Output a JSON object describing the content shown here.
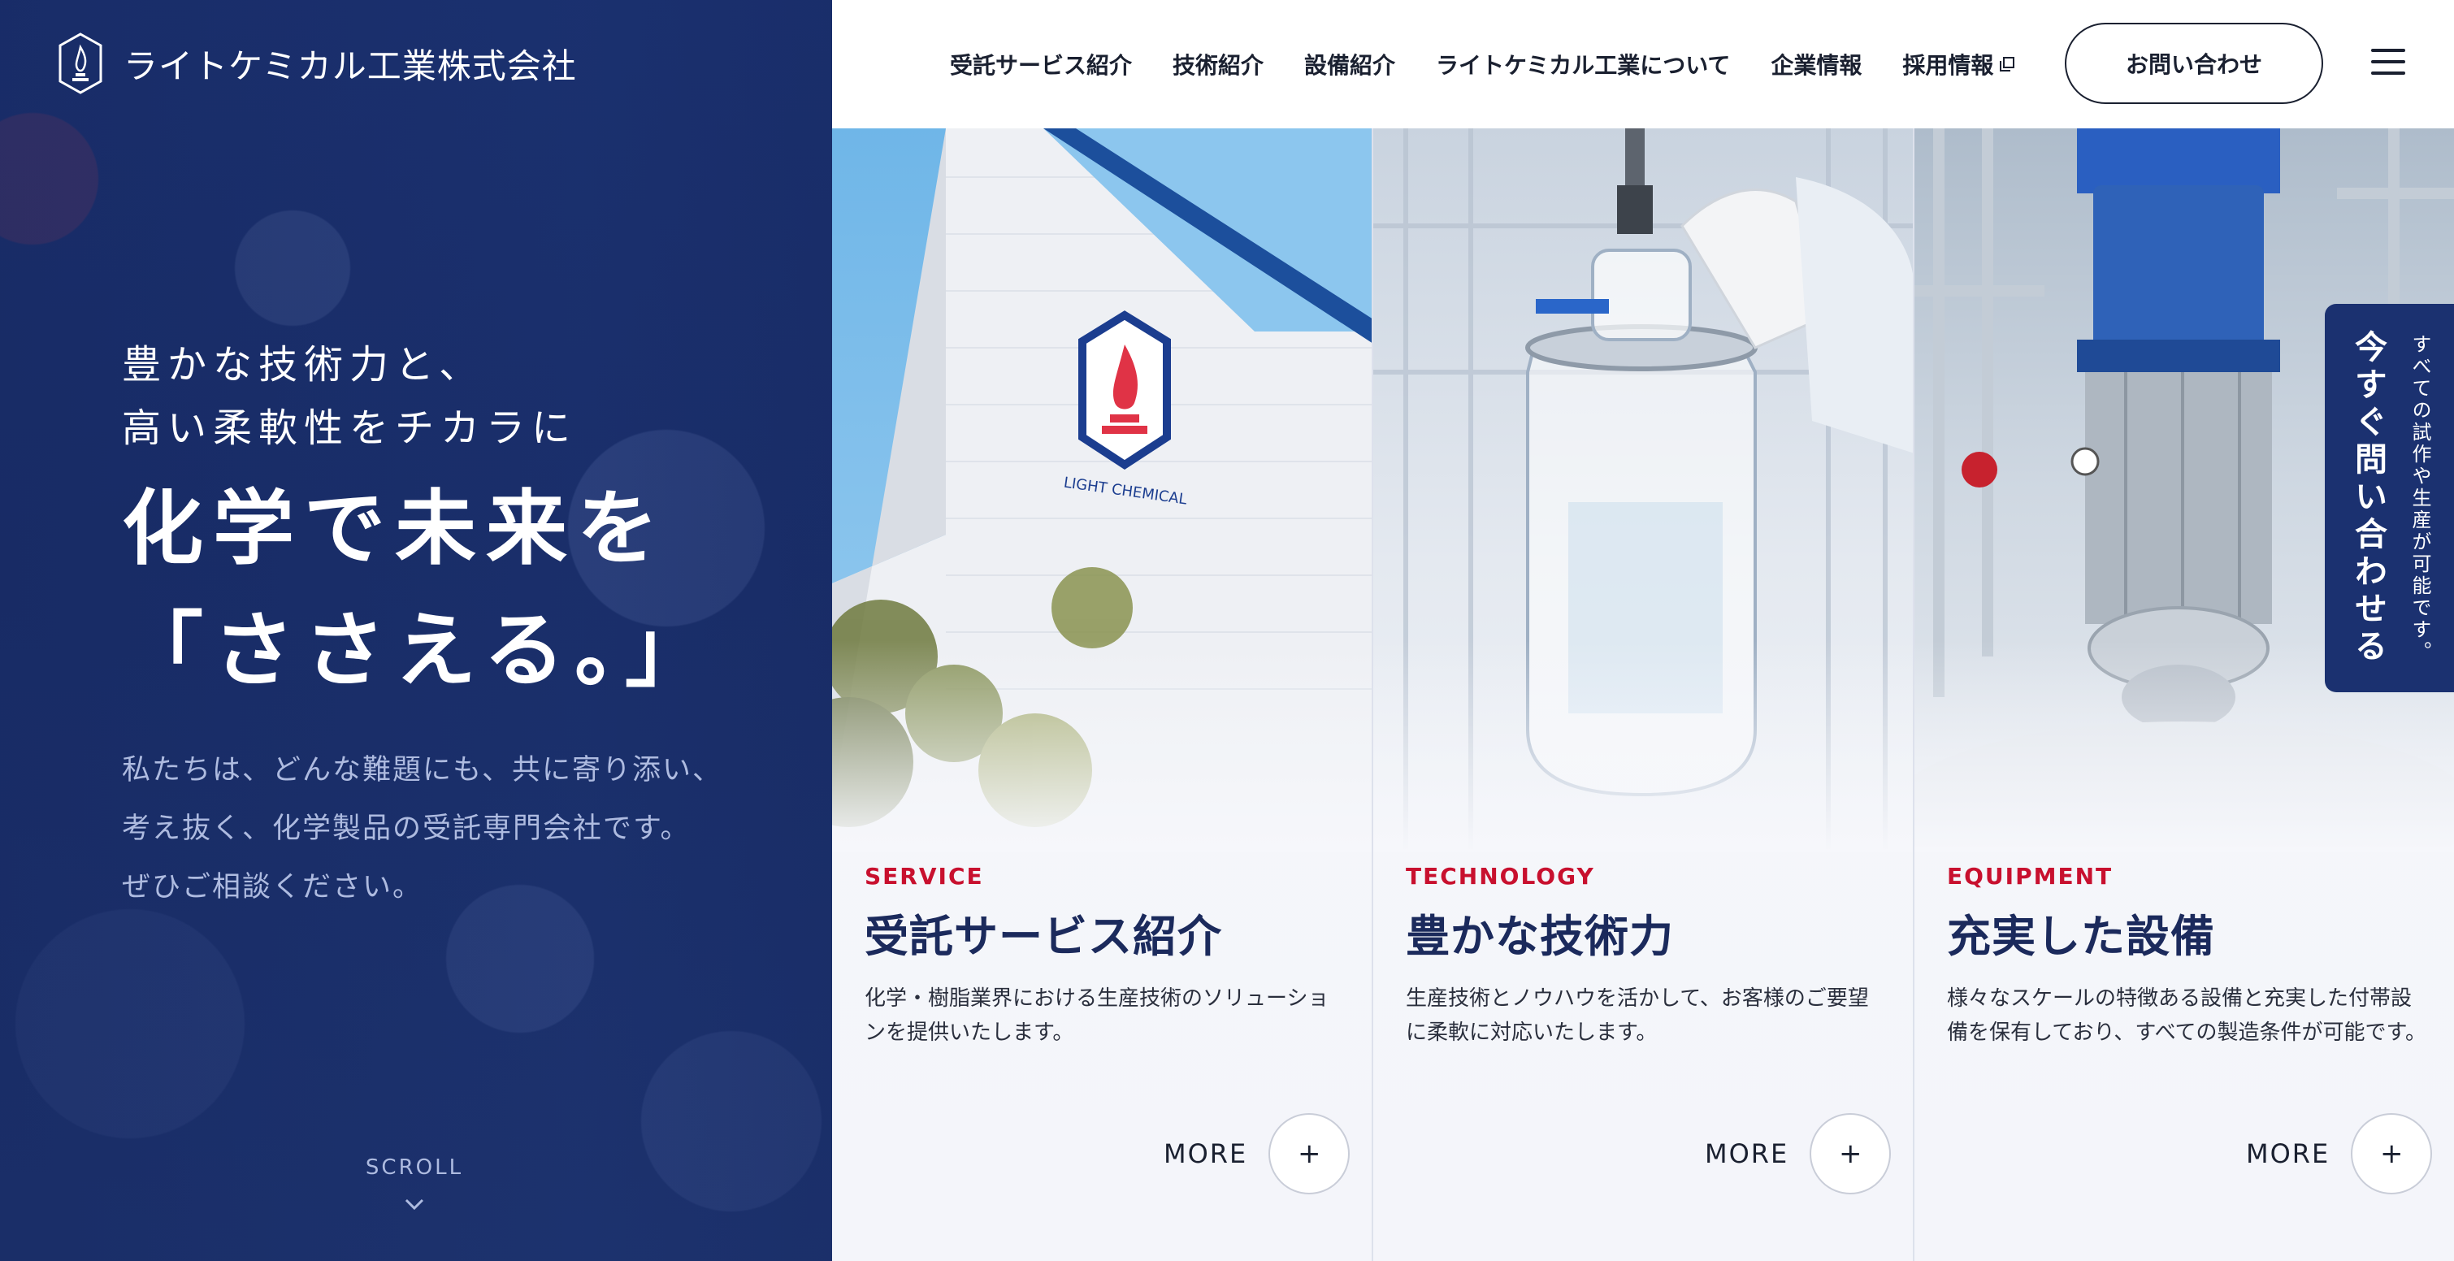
{
  "brand": {
    "company_name": "ライトケミカル工業株式会社"
  },
  "nav": {
    "items": [
      {
        "label": "受託サービス紹介"
      },
      {
        "label": "技術紹介"
      },
      {
        "label": "設備紹介"
      },
      {
        "label": "ライトケミカル工業について"
      },
      {
        "label": "企業情報"
      },
      {
        "label": "採用情報",
        "external": true
      }
    ],
    "contact_label": "お問い合わせ",
    "menu_icon": "hamburger-icon"
  },
  "hero": {
    "lead_line1": "豊かな技術力と、",
    "lead_line2": "高い柔軟性をチカラに",
    "title_line1": "化学で未来を",
    "title_line2": "「ささえる。」",
    "desc_line1": "私たちは、どんな難題にも、共に寄り添い、",
    "desc_line2": "考え抜く、化学製品の受託専門会社です。",
    "desc_line3": "ぜひご相談ください。",
    "scroll_label": "SCROLL"
  },
  "cards": [
    {
      "category": "SERVICE",
      "title": "受託サービス紹介",
      "description": "化学・樹脂業界における生産技術のソリューションを提供いたします。",
      "more_label": "MORE",
      "sign_text": "LIGHT CHEMICAL"
    },
    {
      "category": "TECHNOLOGY",
      "title": "豊かな技術力",
      "description": "生産技術とノウハウを活かして、お客様のご要望に柔軟に対応いたします。",
      "more_label": "MORE"
    },
    {
      "category": "EQUIPMENT",
      "title": "充実した設備",
      "description": "様々なスケールの特徴ある設備と充実した付帯設備を保有しており、すべての製造条件が可能です。",
      "more_label": "MORE"
    }
  ],
  "side_cta": {
    "main": "今すぐ問い合わせる",
    "sub": "すべての試作や生産が可能です。"
  },
  "colors": {
    "navy": "#1b3170",
    "accent_red": "#c8102e",
    "title_navy": "#1b2a5c"
  }
}
